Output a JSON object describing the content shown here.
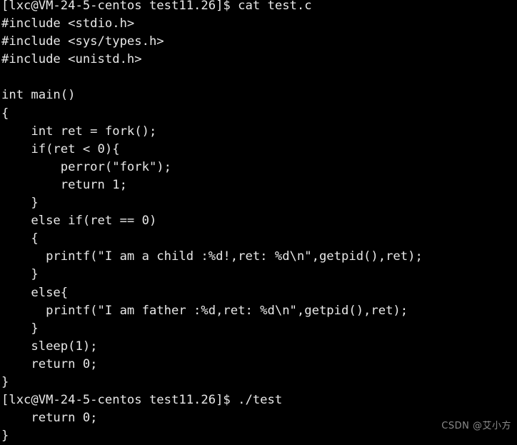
{
  "terminal": {
    "background_color": "#000000",
    "text_color": "#e8e8e8",
    "prompt": "[lxc@VM-24-5-centos test11.26]$",
    "lines": [
      {
        "id": "prompt-cat",
        "text": "[lxc@VM-24-5-centos test11.26]$ cat test.c"
      },
      {
        "id": "include-stdio",
        "text": "#include <stdio.h>"
      },
      {
        "id": "include-sys-types",
        "text": "#include <sys/types.h>"
      },
      {
        "id": "include-unistd",
        "text": "#include <unistd.h>"
      },
      {
        "id": "blank-1",
        "text": " "
      },
      {
        "id": "main-signature",
        "text": "int main()"
      },
      {
        "id": "main-open-brace",
        "text": "{"
      },
      {
        "id": "decl-ret-fork",
        "text": "    int ret = fork();"
      },
      {
        "id": "if-ret-lt-zero",
        "text": "    if(ret < 0){"
      },
      {
        "id": "perror-fork",
        "text": "        perror(\"fork\");"
      },
      {
        "id": "return-one",
        "text": "        return 1;"
      },
      {
        "id": "close-if-brace",
        "text": "    }"
      },
      {
        "id": "else-if-ret-eq-zero",
        "text": "    else if(ret == 0)"
      },
      {
        "id": "child-open-brace",
        "text": "    {"
      },
      {
        "id": "printf-child",
        "text": "      printf(\"I am a child :%d!,ret: %d\\n\",getpid(),ret);"
      },
      {
        "id": "child-close-brace",
        "text": "    }"
      },
      {
        "id": "else-open-brace",
        "text": "    else{"
      },
      {
        "id": "printf-father",
        "text": "      printf(\"I am father :%d,ret: %d\\n\",getpid(),ret);"
      },
      {
        "id": "else-close-brace",
        "text": "    }"
      },
      {
        "id": "sleep-one",
        "text": "    sleep(1);"
      },
      {
        "id": "return-zero",
        "text": "    return 0;"
      },
      {
        "id": "main-close-brace",
        "text": "}"
      },
      {
        "id": "prompt-run-test",
        "text": "[lxc@VM-24-5-centos test11.26]$ ./test"
      },
      {
        "id": "output-return-zero",
        "text": "    return 0;"
      },
      {
        "id": "output-close-brace",
        "text": "}"
      }
    ]
  },
  "watermark": {
    "text": "CSDN @艾小方",
    "color": "#8a8a8a"
  }
}
